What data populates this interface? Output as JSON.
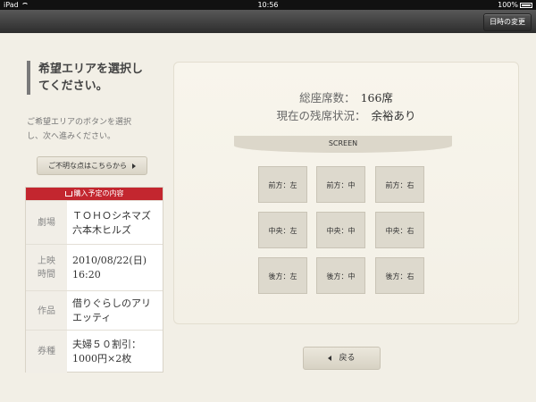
{
  "status_bar": {
    "device": "iPad",
    "time": "10:56",
    "battery": "100%"
  },
  "nav": {
    "change_datetime_label": "日時の変更"
  },
  "sidebar": {
    "title_line1": "希望エリアを選択し",
    "title_line2": "てください。",
    "desc_line1": "ご希望エリアのボタンを選択",
    "desc_line2": "し、次へ進みください。",
    "help_label": "ご不明な点はこちらから"
  },
  "purchase": {
    "header": "購入予定の内容",
    "rows": [
      {
        "label1": "劇場",
        "label2": "",
        "value1": "ＴＯＨＯシネマズ",
        "value2": "六本木ヒルズ"
      },
      {
        "label1": "上映",
        "label2": "時間",
        "value1": "2010/08/22(日)",
        "value2": "16:20"
      },
      {
        "label1": "作品",
        "label2": "",
        "value1": "借りぐらしのアリ",
        "value2": "エッティ"
      },
      {
        "label1": "券種",
        "label2": "",
        "value1": "夫婦５０割引：",
        "value2": "1000円×2枚"
      }
    ]
  },
  "seating": {
    "total_label": "総座席数：",
    "total_value": "166席",
    "status_label": "現在の残席状況：",
    "status_value": "余裕あり",
    "screen_label": "SCREEN",
    "areas": [
      "前方：左",
      "前方：中",
      "前方：右",
      "中央：左",
      "中央：中",
      "中央：右",
      "後方：左",
      "後方：中",
      "後方：右"
    ]
  },
  "back_label": "戻る"
}
